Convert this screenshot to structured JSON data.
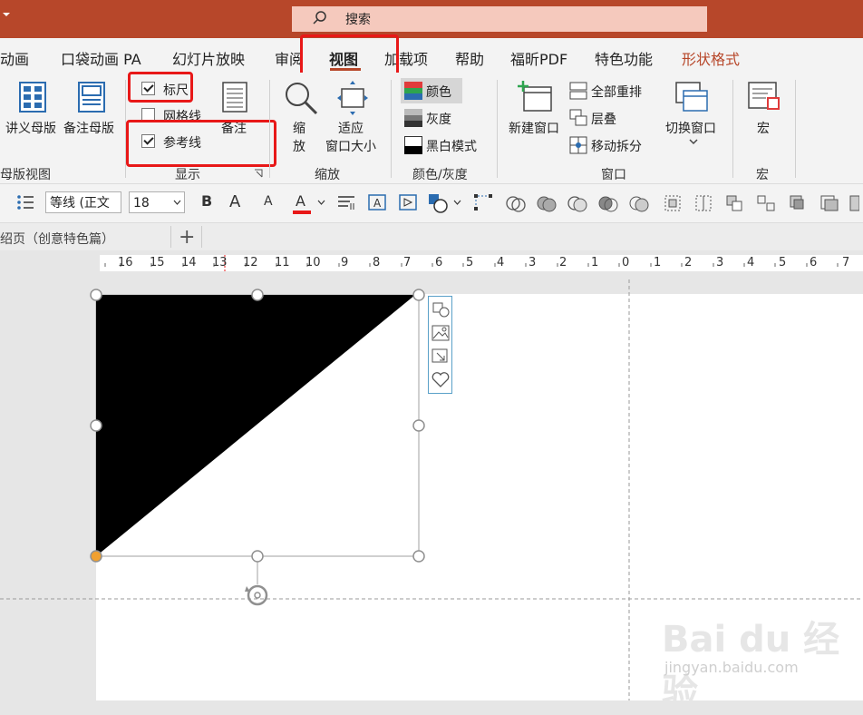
{
  "titlebar": {
    "search_placeholder": "搜索"
  },
  "tabs": [
    "动画",
    "口袋动画 PA",
    "幻灯片放映",
    "审阅",
    "视图",
    "加载项",
    "帮助",
    "福昕PDF",
    "特色功能",
    "形状格式"
  ],
  "active_tab": "视图",
  "ribbon": {
    "master_views": {
      "handout_master": "讲义母版",
      "notes_master": "备注母版",
      "group": "母版视图"
    },
    "show": {
      "ruler": "标尺",
      "gridlines": "网格线",
      "guides": "参考线",
      "notes": "备注",
      "group": "显示"
    },
    "zoom": {
      "zoom_l1": "缩",
      "zoom_l2": "放",
      "fit_l1": "适应",
      "fit_l2": "窗口大小",
      "group": "缩放"
    },
    "color": {
      "color": "颜色",
      "grayscale": "灰度",
      "bw": "黑白模式",
      "group": "颜色/灰度"
    },
    "window": {
      "new_window": "新建窗口",
      "arrange_all": "全部重排",
      "cascade": "层叠",
      "move_split": "移动拆分",
      "switch": "切换窗口",
      "group": "窗口"
    },
    "macros": {
      "macro": "宏",
      "group": "宏"
    }
  },
  "formatbar": {
    "font": "等线 (正文",
    "size": "18",
    "bold": "B",
    "grow": "A",
    "shrink": "A",
    "color": "A"
  },
  "doctab": {
    "name": "绍页（创意特色篇）",
    "add": "+"
  },
  "ruler_labels": [
    "16",
    "15",
    "14",
    "13",
    "12",
    "11",
    "10",
    "9",
    "8",
    "7",
    "6",
    "5",
    "4",
    "3",
    "2",
    "1",
    "0",
    "1",
    "2",
    "3",
    "4",
    "5",
    "6",
    "7"
  ],
  "watermark": {
    "main": "Bai du 经验",
    "sub": "jingyan.baidu.com"
  },
  "colors": {
    "title": "#b7472a",
    "accent_red": "#e81818",
    "shape_fill": "#000000"
  }
}
